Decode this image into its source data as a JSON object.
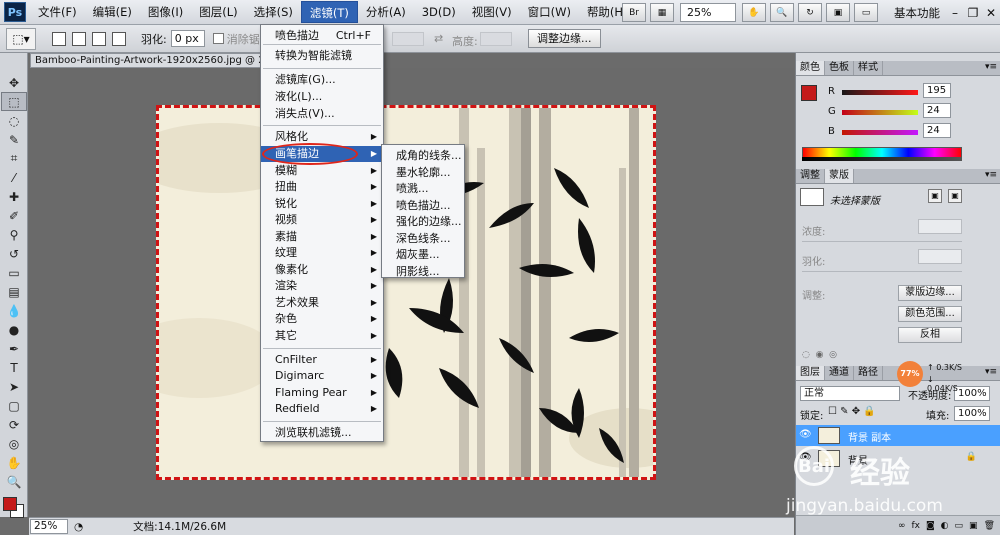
{
  "app": {
    "logo": "Ps"
  },
  "menubar": {
    "items": [
      "文件(F)",
      "编辑(E)",
      "图像(I)",
      "图层(L)",
      "选择(S)",
      "滤镜(T)",
      "分析(A)",
      "3D(D)",
      "视图(V)",
      "窗口(W)",
      "帮助(H)"
    ],
    "active_index": 5,
    "bridge_btn": "Br",
    "zoom_value": "25%",
    "workspace_label": "基本功能"
  },
  "options": {
    "feather_label": "羽化:",
    "feather_value": "0 px",
    "antialias_label": "消除锯齿",
    "height_label": "高度:",
    "refine_edge_button": "调整边缘..."
  },
  "document": {
    "tab_title": "Bamboo-Painting-Artwork-1920x2560.jpg @ 25% (背",
    "status_zoom": "25%",
    "status_doc": "文档:14.1M/26.6M"
  },
  "filter_menu": {
    "items": [
      {
        "label": "喷色描边",
        "shortcut": "Ctrl+F",
        "submenu": false
      },
      {
        "label": "转换为智能滤镜",
        "shortcut": "",
        "submenu": false
      },
      {
        "label": "滤镜库(G)...",
        "shortcut": "",
        "submenu": false
      },
      {
        "label": "液化(L)...",
        "shortcut": "",
        "submenu": false
      },
      {
        "label": "消失点(V)...",
        "shortcut": "",
        "submenu": false
      },
      {
        "label": "风格化",
        "shortcut": "",
        "submenu": true
      },
      {
        "label": "画笔描边",
        "shortcut": "",
        "submenu": true
      },
      {
        "label": "模糊",
        "shortcut": "",
        "submenu": true
      },
      {
        "label": "扭曲",
        "shortcut": "",
        "submenu": true
      },
      {
        "label": "锐化",
        "shortcut": "",
        "submenu": true
      },
      {
        "label": "视频",
        "shortcut": "",
        "submenu": true
      },
      {
        "label": "素描",
        "shortcut": "",
        "submenu": true
      },
      {
        "label": "纹理",
        "shortcut": "",
        "submenu": true
      },
      {
        "label": "像素化",
        "shortcut": "",
        "submenu": true
      },
      {
        "label": "渲染",
        "shortcut": "",
        "submenu": true
      },
      {
        "label": "艺术效果",
        "shortcut": "",
        "submenu": true
      },
      {
        "label": "杂色",
        "shortcut": "",
        "submenu": true
      },
      {
        "label": "其它",
        "shortcut": "",
        "submenu": true
      },
      {
        "label": "CnFilter",
        "shortcut": "",
        "submenu": true
      },
      {
        "label": "Digimarc",
        "shortcut": "",
        "submenu": true
      },
      {
        "label": "Flaming Pear",
        "shortcut": "",
        "submenu": true
      },
      {
        "label": "Redfield",
        "shortcut": "",
        "submenu": true
      },
      {
        "label": "浏览联机滤镜...",
        "shortcut": "",
        "submenu": false
      }
    ],
    "highlighted_index": 6
  },
  "brush_strokes_submenu": [
    "成角的线条...",
    "墨水轮廓...",
    "喷溅...",
    "喷色描边...",
    "强化的边缘...",
    "深色线条...",
    "烟灰墨...",
    "阴影线..."
  ],
  "color_panel": {
    "tabs": [
      "颜色",
      "色板",
      "样式"
    ],
    "channels": [
      {
        "name": "R",
        "value": "195"
      },
      {
        "name": "G",
        "value": "24"
      },
      {
        "name": "B",
        "value": "24"
      }
    ],
    "fg_color": "#c31818"
  },
  "adjust_panel": {
    "tabs": [
      "调整",
      "蒙版"
    ],
    "mask_title": "未选择蒙版",
    "density_label": "浓度:",
    "feather_label": "羽化:",
    "refine_label": "调整:",
    "btn_mask_edge": "蒙版边缘...",
    "btn_color_range": "颜色范围...",
    "btn_invert": "反相"
  },
  "layers_panel": {
    "tabs": [
      "图层",
      "通道",
      "路径"
    ],
    "blend_mode": "正常",
    "opacity_label": "不透明度:",
    "opacity_value": "100%",
    "lock_label": "锁定:",
    "fill_label": "填充:",
    "fill_value": "100%",
    "layers": [
      {
        "name": "背景 副本",
        "selected": true
      },
      {
        "name": "背景",
        "selected": false
      }
    ]
  },
  "net_widget": {
    "percent": "77%",
    "up": "0.3K/S",
    "down": "0.04K/S"
  },
  "watermark": {
    "brand": "经验",
    "url": "jingyan.baidu.com"
  }
}
